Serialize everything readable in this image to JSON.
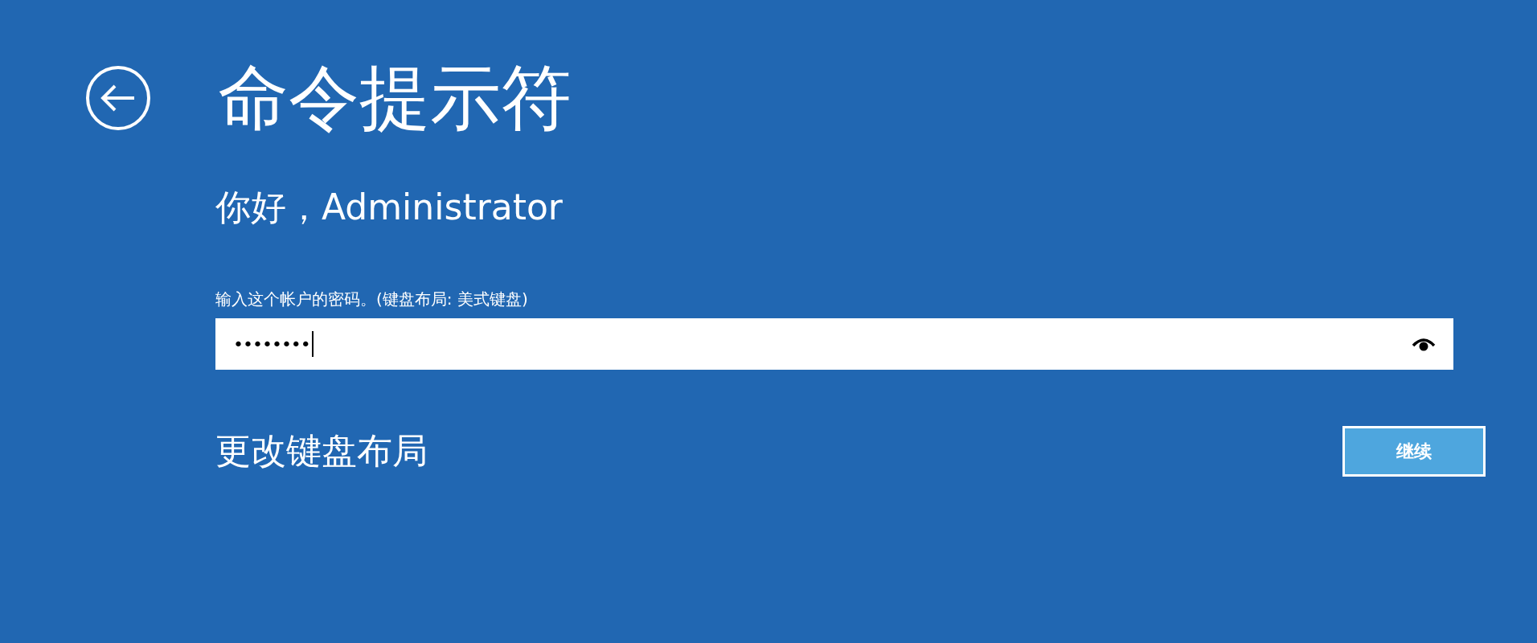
{
  "title": "命令提示符",
  "greeting": "你好，Administrator",
  "password": {
    "label": "输入这个帐户的密码。(键盘布局: 美式键盘)",
    "value": "••••••••"
  },
  "change_layout_link": "更改键盘布局",
  "buttons": [
    "继续"
  ]
}
